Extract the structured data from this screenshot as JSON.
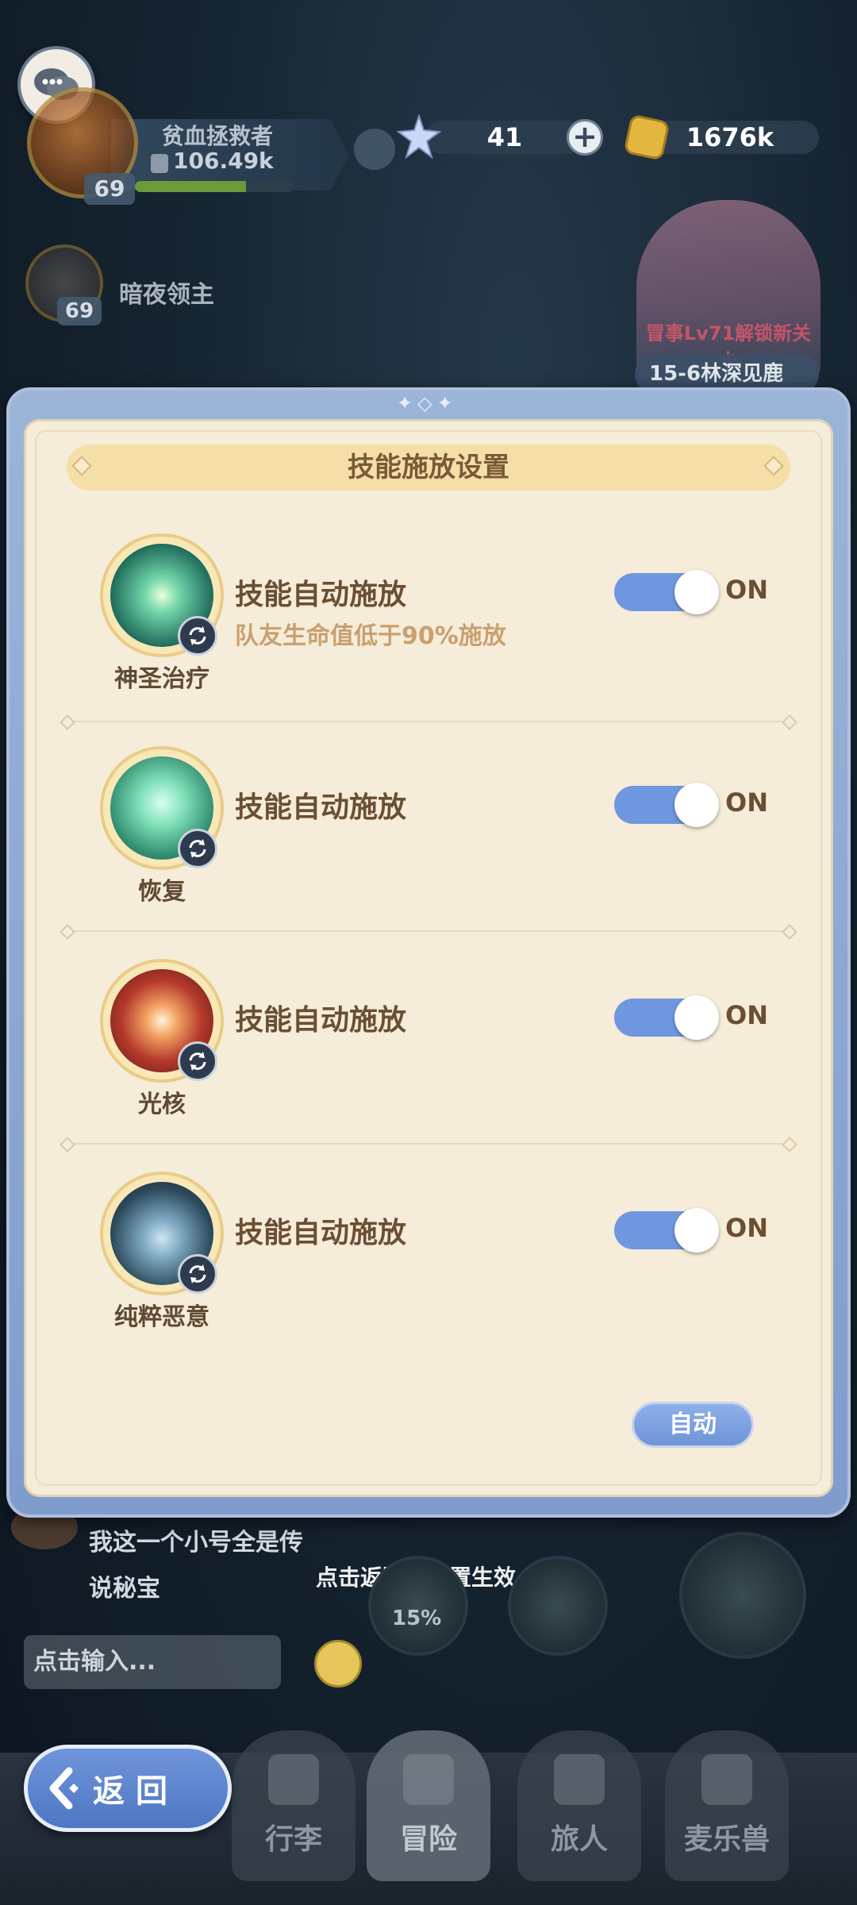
{
  "hud": {
    "player_name": "贫血拯救者",
    "player_power": "106.49k",
    "player_level": "69",
    "player_hp_fraction": 0.7,
    "stars": "41",
    "coins": "1676k",
    "boss_name": "暗夜领主",
    "boss_level": "69",
    "event_text": "冒事Lv71解锁新关卡",
    "event_stage": "15-6林深见鹿"
  },
  "modal": {
    "title": "技能施放设置",
    "skills": [
      {
        "name": "神圣治疗",
        "label": "技能自动施放",
        "sub": "队友生命值低于90%施放",
        "state": "ON",
        "enabled": true,
        "color": "#1f6b5a"
      },
      {
        "name": "恢复",
        "label": "技能自动施放",
        "sub": "",
        "state": "ON",
        "enabled": true,
        "color": "#2f8a6e"
      },
      {
        "name": "光核",
        "label": "技能自动施放",
        "sub": "",
        "state": "ON",
        "enabled": true,
        "color": "#8a2a24"
      },
      {
        "name": "纯粹恶意",
        "label": "技能自动施放",
        "sub": "",
        "state": "ON",
        "enabled": true,
        "color": "#2c4a5c"
      }
    ],
    "auto_button": "自动"
  },
  "bottom": {
    "chat_line1": "我这一个小号全是传",
    "chat_line2": "说秘宝",
    "hint": "点击返回后设置生效",
    "orb_percent": "15%",
    "chat_placeholder": "点击输入...",
    "back_label": "返回",
    "nav": [
      "行李",
      "冒险",
      "旅人",
      "麦乐兽"
    ]
  },
  "colors": {
    "toggle_on": "#6f97e0",
    "panel_bg": "#f5ecd9",
    "frame": "#8aa6d4"
  }
}
